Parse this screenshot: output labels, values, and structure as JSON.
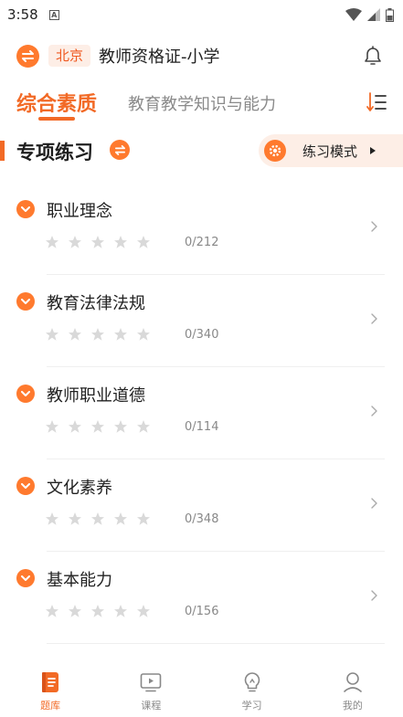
{
  "status_bar": {
    "time": "3:58",
    "notification_glyph": "A"
  },
  "header": {
    "city": "北京",
    "exam": "教师资格证-小学"
  },
  "tabs": [
    {
      "label": "综合素质",
      "active": true
    },
    {
      "label": "教育教学知识与能力",
      "active": false
    }
  ],
  "section": {
    "title": "专项练习",
    "mode_label": "练习模式"
  },
  "topics": [
    {
      "title": "职业理念",
      "progress": "0/212",
      "stars_filled": 0
    },
    {
      "title": "教育法律法规",
      "progress": "0/340",
      "stars_filled": 0
    },
    {
      "title": "教师职业道德",
      "progress": "0/114",
      "stars_filled": 0
    },
    {
      "title": "文化素养",
      "progress": "0/348",
      "stars_filled": 0
    },
    {
      "title": "基本能力",
      "progress": "0/156",
      "stars_filled": 0
    }
  ],
  "bottom_nav": [
    {
      "label": "题库",
      "icon": "question-bank-icon",
      "active": true
    },
    {
      "label": "课程",
      "icon": "course-video-icon",
      "active": false
    },
    {
      "label": "学习",
      "icon": "lightbulb-icon",
      "active": false
    },
    {
      "label": "我的",
      "icon": "profile-icon",
      "active": false
    }
  ],
  "colors": {
    "accent": "#f26a26",
    "accent_light": "#fdeee6",
    "star_empty": "#d9d9d9",
    "text": "#222222",
    "muted": "#888888"
  }
}
